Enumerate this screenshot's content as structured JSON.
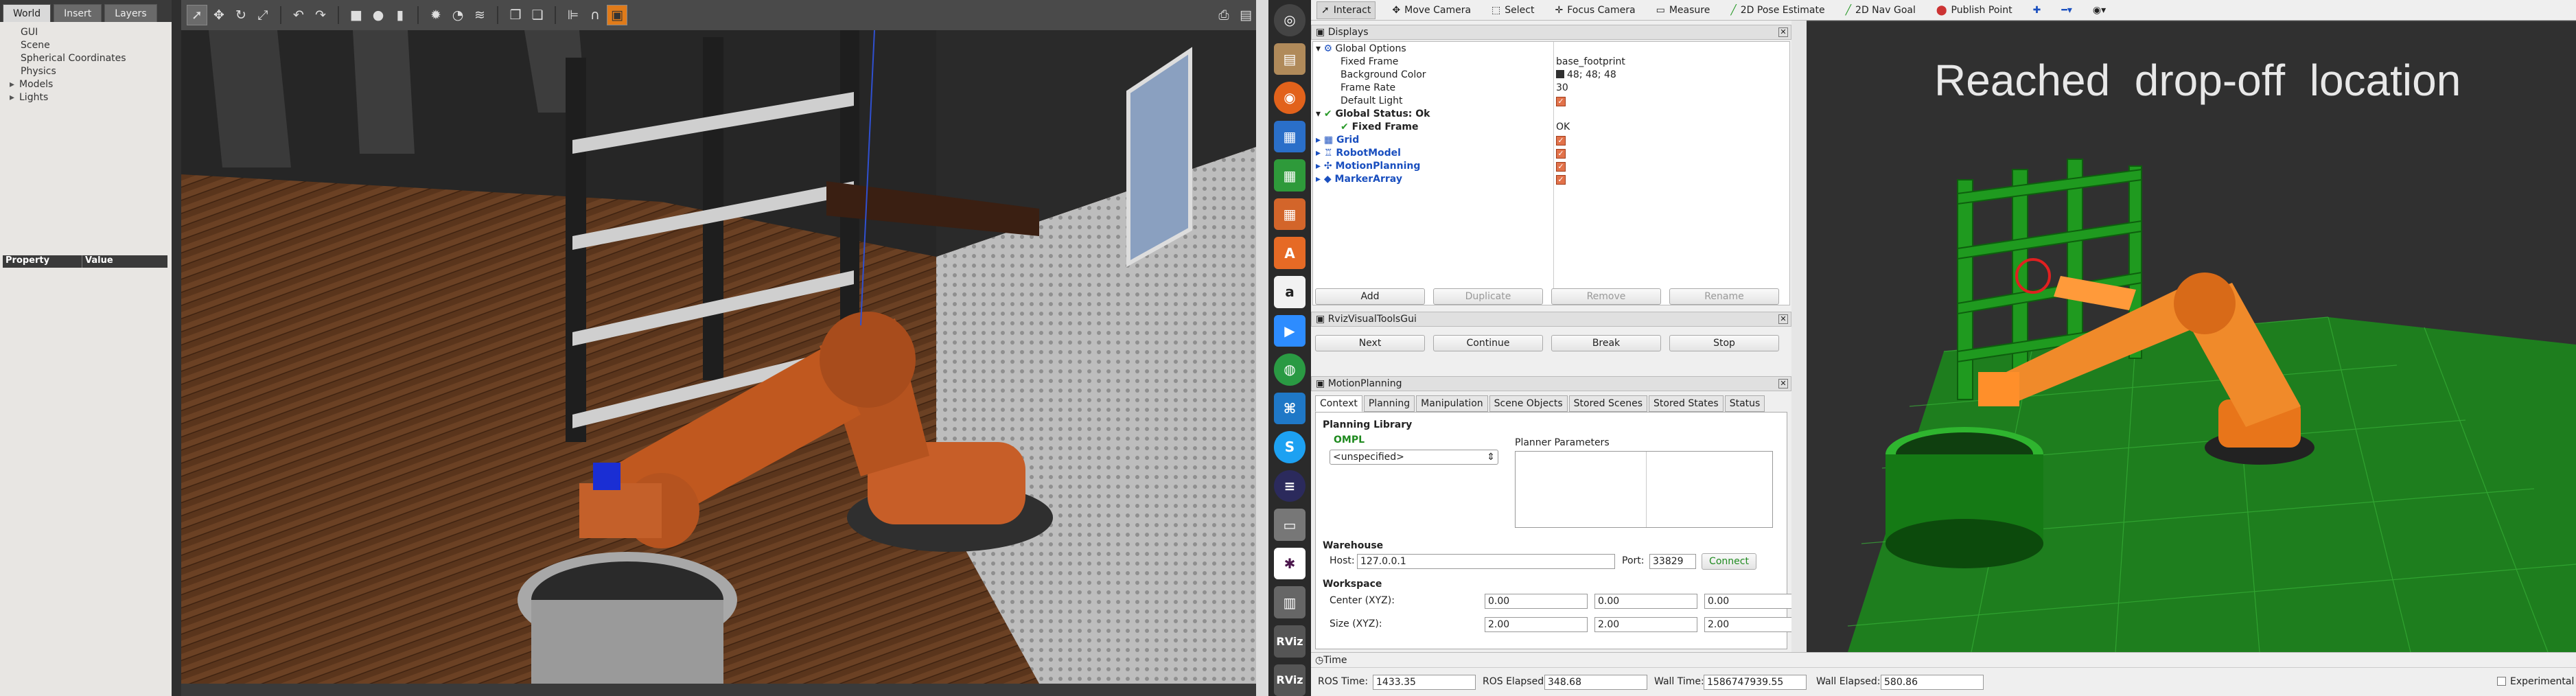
{
  "gazebo": {
    "tabs": [
      "World",
      "Insert",
      "Layers"
    ],
    "tree": [
      "GUI",
      "Scene",
      "Spherical Coordinates",
      "Physics",
      "Models",
      "Lights"
    ],
    "prop_headers": [
      "Property",
      "Value"
    ]
  },
  "rviz": {
    "tools": [
      "Interact",
      "Move Camera",
      "Select",
      "Focus Camera",
      "Measure",
      "2D Pose Estimate",
      "2D Nav Goal",
      "Publish Point"
    ],
    "displays": {
      "title": "Displays",
      "global_options": "Global Options",
      "fixed_frame_label": "Fixed Frame",
      "fixed_frame_value": "base_footprint",
      "bg_label": "Background Color",
      "bg_value": "48; 48; 48",
      "frame_rate_label": "Frame Rate",
      "frame_rate_value": "30",
      "default_light_label": "Default Light",
      "global_status": "Global Status: Ok",
      "status_fixed_frame": "Fixed Frame",
      "status_fixed_value": "OK",
      "items": [
        "Grid",
        "RobotModel",
        "MotionPlanning",
        "MarkerArray"
      ],
      "buttons": [
        "Add",
        "Duplicate",
        "Remove",
        "Rename"
      ]
    },
    "rvt": {
      "title": "RvizVisualToolsGui",
      "buttons": [
        "Next",
        "Continue",
        "Break",
        "Stop"
      ]
    },
    "mp": {
      "title": "MotionPlanning",
      "tabs": [
        "Context",
        "Planning",
        "Manipulation",
        "Scene Objects",
        "Stored Scenes",
        "Stored States",
        "Status"
      ],
      "planning_library": "Planning Library",
      "ompl": "OMPL",
      "planner_select": "<unspecified>",
      "planner_params": "Planner Parameters",
      "warehouse": "Warehouse",
      "host_label": "Host:",
      "host_value": "127.0.0.1",
      "port_label": "Port:",
      "port_value": "33829",
      "connect": "Connect",
      "workspace": "Workspace",
      "center_label": "Center (XYZ):",
      "center": [
        "0.00",
        "0.00",
        "0.00"
      ],
      "size_label": "Size (XYZ):",
      "size": [
        "2.00",
        "2.00",
        "2.00"
      ]
    },
    "time": {
      "title": "Time",
      "ros_time_label": "ROS Time:",
      "ros_time": "1433.35",
      "ros_elapsed_label": "ROS Elapsed:",
      "ros_elapsed": "348.68",
      "wall_time_label": "Wall Time:",
      "wall_time": "1586747939.55",
      "wall_elapsed_label": "Wall Elapsed:",
      "wall_elapsed": "580.86",
      "experimental": "Experimental"
    },
    "overlay_text": "Reached  drop-off  location"
  },
  "colors": {
    "grid_green": "#2fa32f",
    "robot_orange": "#e8751a",
    "background": "#303030"
  }
}
